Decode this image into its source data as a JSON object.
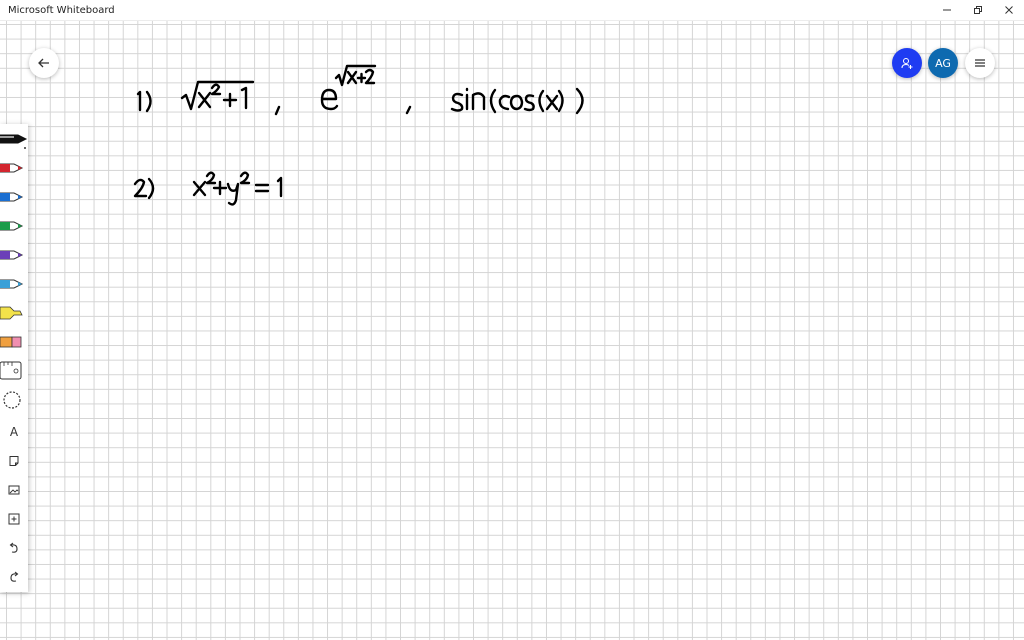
{
  "window": {
    "title": "Microsoft Whiteboard",
    "controls": [
      "minimize",
      "restore",
      "close"
    ]
  },
  "topbar": {
    "back_icon": "arrow-left-icon",
    "share_icon": "person-add-icon",
    "avatar_initials": "AG",
    "menu_icon": "hamburger-menu-icon"
  },
  "toolbar": {
    "tools": [
      {
        "name": "pen-black",
        "color": "#111111"
      },
      {
        "name": "pen-red",
        "color": "#d3262f"
      },
      {
        "name": "pen-blue",
        "color": "#1b6fd1"
      },
      {
        "name": "pen-green",
        "color": "#1b9c4a"
      },
      {
        "name": "pen-purple",
        "color": "#6b3fb8"
      },
      {
        "name": "pen-light-blue",
        "color": "#3aa0d8"
      },
      {
        "name": "highlighter-yellow",
        "color": "#f3e24a"
      },
      {
        "name": "eraser",
        "color": "#f0a040"
      },
      {
        "name": "ruler",
        "color": "#555555"
      },
      {
        "name": "lasso-select",
        "color": "#555555"
      }
    ],
    "text_tool_label": "A",
    "action_icons": [
      "note-icon",
      "image-icon",
      "add-icon",
      "undo-icon",
      "redo-icon"
    ]
  },
  "colors": {
    "accent_blue": "#1f3cf2",
    "avatar_blue": "#0e6ab0",
    "grid": "#d4d4d4"
  },
  "canvas": {
    "ink_line_1": "1) √(x²+1) , e^√(x+2) , sin(cos(x))",
    "ink_line_2": "2) x²+y²=1"
  }
}
